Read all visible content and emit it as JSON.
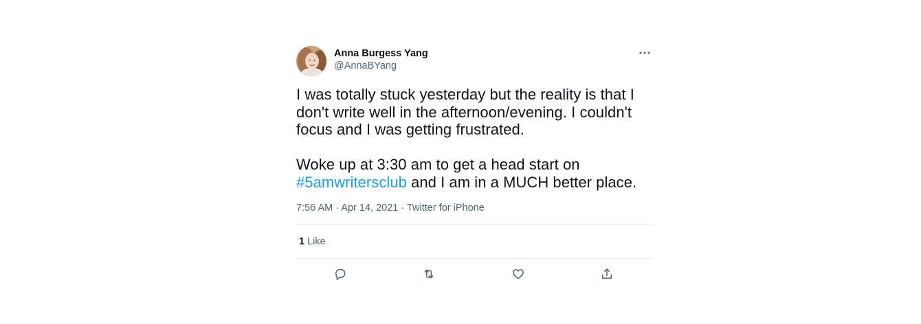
{
  "tweet": {
    "author": {
      "display_name": "Anna Burgess Yang",
      "handle": "@AnnaBYang"
    },
    "text": {
      "paragraph1": "I was totally stuck yesterday but the reality is that I don't write well in the afternoon/evening. I couldn't focus and I was getting frustrated.",
      "paragraph2_before": "Woke up at 3:30 am to get a head start on ",
      "hashtag": "#5amwritersclub",
      "paragraph2_after": " and I am in a MUCH better place."
    },
    "meta": {
      "time": "7:56 AM",
      "separator": " · ",
      "date": "Apr 14, 2021",
      "source": "Twitter for iPhone"
    },
    "engagement": {
      "like_count": "1",
      "like_label": "Like"
    },
    "icons": {
      "more": "more-horizontal-icon",
      "reply": "reply-icon",
      "retweet": "retweet-icon",
      "like": "heart-icon",
      "share": "share-icon"
    },
    "colors": {
      "text": "#0f1419",
      "secondary": "#536471",
      "link": "#1d9bf0",
      "divider": "#e6ecf0"
    }
  }
}
